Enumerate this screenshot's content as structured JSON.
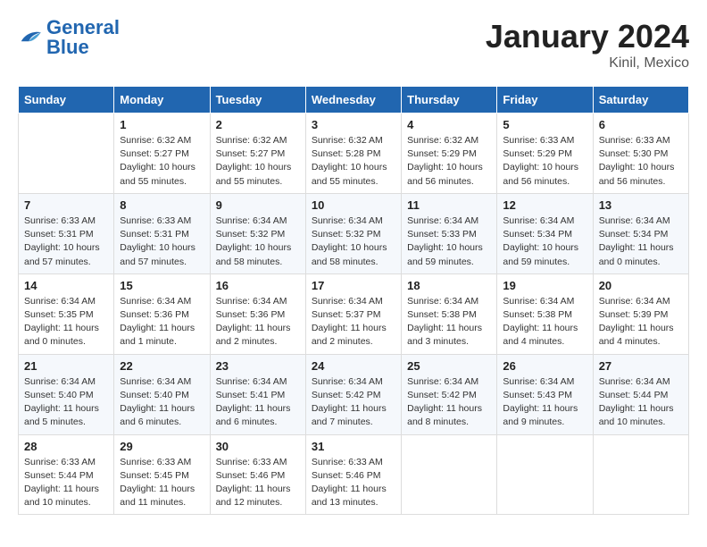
{
  "logo": {
    "general": "General",
    "blue": "Blue"
  },
  "title": "January 2024",
  "subtitle": "Kinil, Mexico",
  "days_of_week": [
    "Sunday",
    "Monday",
    "Tuesday",
    "Wednesday",
    "Thursday",
    "Friday",
    "Saturday"
  ],
  "weeks": [
    [
      {
        "day": "",
        "info": ""
      },
      {
        "day": "1",
        "info": "Sunrise: 6:32 AM\nSunset: 5:27 PM\nDaylight: 10 hours\nand 55 minutes."
      },
      {
        "day": "2",
        "info": "Sunrise: 6:32 AM\nSunset: 5:27 PM\nDaylight: 10 hours\nand 55 minutes."
      },
      {
        "day": "3",
        "info": "Sunrise: 6:32 AM\nSunset: 5:28 PM\nDaylight: 10 hours\nand 55 minutes."
      },
      {
        "day": "4",
        "info": "Sunrise: 6:32 AM\nSunset: 5:29 PM\nDaylight: 10 hours\nand 56 minutes."
      },
      {
        "day": "5",
        "info": "Sunrise: 6:33 AM\nSunset: 5:29 PM\nDaylight: 10 hours\nand 56 minutes."
      },
      {
        "day": "6",
        "info": "Sunrise: 6:33 AM\nSunset: 5:30 PM\nDaylight: 10 hours\nand 56 minutes."
      }
    ],
    [
      {
        "day": "7",
        "info": "Sunrise: 6:33 AM\nSunset: 5:31 PM\nDaylight: 10 hours\nand 57 minutes."
      },
      {
        "day": "8",
        "info": "Sunrise: 6:33 AM\nSunset: 5:31 PM\nDaylight: 10 hours\nand 57 minutes."
      },
      {
        "day": "9",
        "info": "Sunrise: 6:34 AM\nSunset: 5:32 PM\nDaylight: 10 hours\nand 58 minutes."
      },
      {
        "day": "10",
        "info": "Sunrise: 6:34 AM\nSunset: 5:32 PM\nDaylight: 10 hours\nand 58 minutes."
      },
      {
        "day": "11",
        "info": "Sunrise: 6:34 AM\nSunset: 5:33 PM\nDaylight: 10 hours\nand 59 minutes."
      },
      {
        "day": "12",
        "info": "Sunrise: 6:34 AM\nSunset: 5:34 PM\nDaylight: 10 hours\nand 59 minutes."
      },
      {
        "day": "13",
        "info": "Sunrise: 6:34 AM\nSunset: 5:34 PM\nDaylight: 11 hours\nand 0 minutes."
      }
    ],
    [
      {
        "day": "14",
        "info": "Sunrise: 6:34 AM\nSunset: 5:35 PM\nDaylight: 11 hours\nand 0 minutes."
      },
      {
        "day": "15",
        "info": "Sunrise: 6:34 AM\nSunset: 5:36 PM\nDaylight: 11 hours\nand 1 minute."
      },
      {
        "day": "16",
        "info": "Sunrise: 6:34 AM\nSunset: 5:36 PM\nDaylight: 11 hours\nand 2 minutes."
      },
      {
        "day": "17",
        "info": "Sunrise: 6:34 AM\nSunset: 5:37 PM\nDaylight: 11 hours\nand 2 minutes."
      },
      {
        "day": "18",
        "info": "Sunrise: 6:34 AM\nSunset: 5:38 PM\nDaylight: 11 hours\nand 3 minutes."
      },
      {
        "day": "19",
        "info": "Sunrise: 6:34 AM\nSunset: 5:38 PM\nDaylight: 11 hours\nand 4 minutes."
      },
      {
        "day": "20",
        "info": "Sunrise: 6:34 AM\nSunset: 5:39 PM\nDaylight: 11 hours\nand 4 minutes."
      }
    ],
    [
      {
        "day": "21",
        "info": "Sunrise: 6:34 AM\nSunset: 5:40 PM\nDaylight: 11 hours\nand 5 minutes."
      },
      {
        "day": "22",
        "info": "Sunrise: 6:34 AM\nSunset: 5:40 PM\nDaylight: 11 hours\nand 6 minutes."
      },
      {
        "day": "23",
        "info": "Sunrise: 6:34 AM\nSunset: 5:41 PM\nDaylight: 11 hours\nand 6 minutes."
      },
      {
        "day": "24",
        "info": "Sunrise: 6:34 AM\nSunset: 5:42 PM\nDaylight: 11 hours\nand 7 minutes."
      },
      {
        "day": "25",
        "info": "Sunrise: 6:34 AM\nSunset: 5:42 PM\nDaylight: 11 hours\nand 8 minutes."
      },
      {
        "day": "26",
        "info": "Sunrise: 6:34 AM\nSunset: 5:43 PM\nDaylight: 11 hours\nand 9 minutes."
      },
      {
        "day": "27",
        "info": "Sunrise: 6:34 AM\nSunset: 5:44 PM\nDaylight: 11 hours\nand 10 minutes."
      }
    ],
    [
      {
        "day": "28",
        "info": "Sunrise: 6:33 AM\nSunset: 5:44 PM\nDaylight: 11 hours\nand 10 minutes."
      },
      {
        "day": "29",
        "info": "Sunrise: 6:33 AM\nSunset: 5:45 PM\nDaylight: 11 hours\nand 11 minutes."
      },
      {
        "day": "30",
        "info": "Sunrise: 6:33 AM\nSunset: 5:46 PM\nDaylight: 11 hours\nand 12 minutes."
      },
      {
        "day": "31",
        "info": "Sunrise: 6:33 AM\nSunset: 5:46 PM\nDaylight: 11 hours\nand 13 minutes."
      },
      {
        "day": "",
        "info": ""
      },
      {
        "day": "",
        "info": ""
      },
      {
        "day": "",
        "info": ""
      }
    ]
  ]
}
